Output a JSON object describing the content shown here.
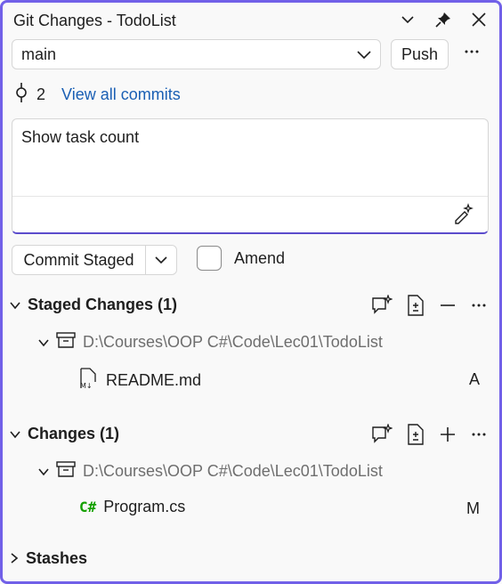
{
  "window": {
    "title": "Git Changes - TodoList"
  },
  "branch": {
    "name": "main"
  },
  "push": {
    "label": "Push"
  },
  "commits": {
    "count": "2",
    "link": "View all commits"
  },
  "message": {
    "text": "Show task count"
  },
  "commit": {
    "label": "Commit Staged",
    "amend_label": "Amend"
  },
  "staged": {
    "title": "Staged Changes (1)",
    "repo_path": "D:\\Courses\\OOP C#\\Code\\Lec01\\TodoList",
    "files": [
      {
        "name": "README.md",
        "status": "A",
        "icon": "markdown-file-icon"
      }
    ]
  },
  "changes": {
    "title": "Changes (1)",
    "repo_path": "D:\\Courses\\OOP C#\\Code\\Lec01\\TodoList",
    "files": [
      {
        "name": "Program.cs",
        "status": "M",
        "icon": "csharp-file-icon",
        "icon_text": "C#"
      }
    ]
  },
  "stashes": {
    "title": "Stashes"
  },
  "colors": {
    "accent": "#7160e8",
    "link": "#1a5fb4",
    "csharp": "#14a000"
  }
}
